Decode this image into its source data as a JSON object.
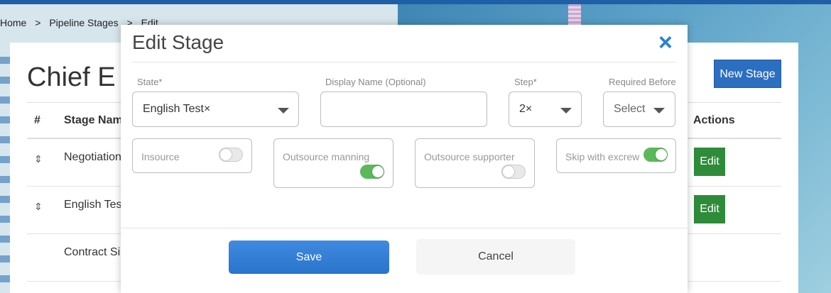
{
  "breadcrumb": {
    "items": [
      "Home",
      ">",
      "Pipeline Stages",
      ">",
      "Edit"
    ]
  },
  "page": {
    "title": "Chief E",
    "new_stage_label": "New Stage",
    "table": {
      "headers": {
        "hash": "#",
        "stage_name": "Stage Nam",
        "actions": "Actions"
      },
      "rows": [
        {
          "name": "Negotiation",
          "edit_label": "Edit"
        },
        {
          "name": "English Tes",
          "edit_label": "Edit"
        },
        {
          "name": "Contract Si"
        }
      ]
    }
  },
  "modal": {
    "title": "Edit Stage",
    "close_symbol": "×",
    "fields": {
      "state": {
        "label": "State",
        "required": "*",
        "value": "English Test×"
      },
      "display_name": {
        "label": "Display Name (Optional)",
        "value": ""
      },
      "step": {
        "label": "Step",
        "required": "*",
        "value": "2×"
      },
      "required_before": {
        "label": "Required Before",
        "value": "Select"
      }
    },
    "toggles": [
      {
        "label": "Insource",
        "on": false
      },
      {
        "label": "Outsource manning",
        "on": true
      },
      {
        "label": "Outsource supporter",
        "on": false
      },
      {
        "label": "Skip with excrew",
        "on": true
      }
    ],
    "save_label": "Save",
    "cancel_label": "Cancel"
  },
  "colors": {
    "accent": "#2a7fd4",
    "success": "#2e8b3a",
    "toggle_on": "#5cb85c"
  }
}
